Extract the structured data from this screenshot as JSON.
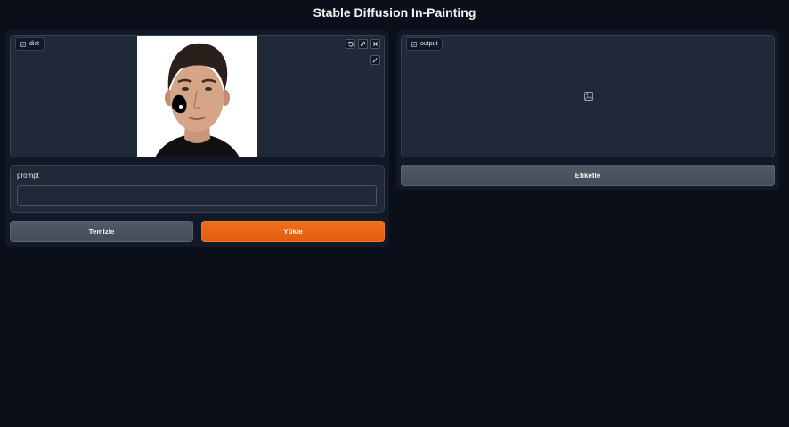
{
  "header": {
    "title": "Stable Diffusion In-Painting"
  },
  "left": {
    "image_block": {
      "label": "dict",
      "label_icon": "image-icon"
    },
    "tools": {
      "undo_icon": "undo-icon",
      "edit_icon": "pencil-icon",
      "clear_icon": "close-icon",
      "brush_icon": "brush-icon"
    },
    "prompt": {
      "label": "prompt",
      "value": "",
      "placeholder": ""
    },
    "buttons": {
      "clear_label": "Temizle",
      "submit_label": "Yükle"
    }
  },
  "right": {
    "output_block": {
      "label": "output",
      "label_icon": "image-icon",
      "empty_icon": "image-placeholder-icon"
    },
    "buttons": {
      "tag_label": "Etiketle"
    }
  },
  "colors": {
    "background": "#0b0f19",
    "panel": "#1f2937",
    "border": "#374151",
    "primary": "#e8650f",
    "secondary": "#4b5563"
  }
}
